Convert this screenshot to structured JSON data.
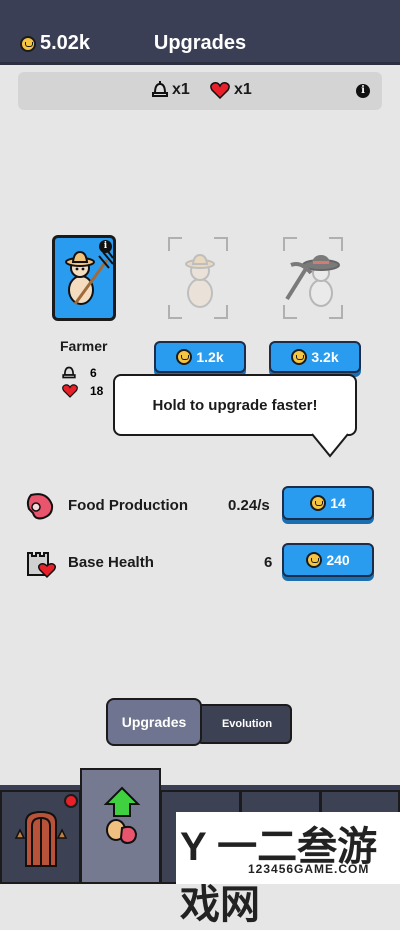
{
  "header": {
    "coins": "5.02k",
    "title": "Upgrades"
  },
  "stats": {
    "soldiers": "x1",
    "hearts": "x1"
  },
  "units": [
    {
      "name": "Farmer",
      "soldier_count": "6",
      "heart_count": "18",
      "locked": false
    },
    {
      "cost": "1.2k",
      "locked": true
    },
    {
      "cost": "3.2k",
      "locked": true
    }
  ],
  "tooltip": "Hold to upgrade faster!",
  "upgrades": [
    {
      "label": "Food Production",
      "value": "0.24/s",
      "cost": "14"
    },
    {
      "label": "Base Health",
      "value": "6",
      "cost": "240"
    }
  ],
  "tabs": {
    "upgrades": "Upgrades",
    "evolution": "Evolution",
    "active": "upgrades"
  },
  "watermark": {
    "main": "Y 一二叁游戏网",
    "sub": "123456GAME.COM"
  },
  "colors": {
    "accent": "#2a9cf0",
    "topbar": "#3b3f55",
    "badge": "#e8202a",
    "heart": "#e8202a"
  }
}
